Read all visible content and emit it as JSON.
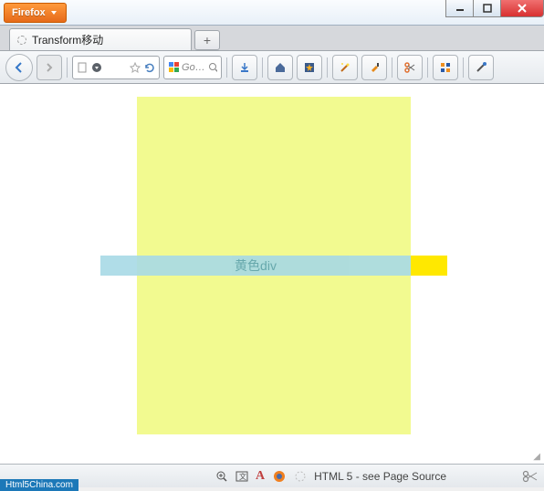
{
  "app": {
    "menu_label": "Firefox"
  },
  "window_controls": {
    "min": "minimize",
    "max": "maximize",
    "close": "close"
  },
  "tabs": [
    {
      "title": "Transform移动"
    }
  ],
  "newtab": "+",
  "search": {
    "placeholder": "Go…",
    "engine": "google"
  },
  "content": {
    "yellow_div_label": "黄色div",
    "yellow_box_color": "#f2fa90",
    "cyan_bar_color": "#a7d9e5",
    "yellow_bar_color": "#ffe800"
  },
  "status": {
    "zoom_icons": [
      "zoom-in",
      "text-encoding",
      "font"
    ],
    "fox_icon": "firefox-orange",
    "loading_icon": "spinner",
    "text": "HTML 5 - see Page Source",
    "scissors": "scissors"
  },
  "watermark": "Html5China.com"
}
